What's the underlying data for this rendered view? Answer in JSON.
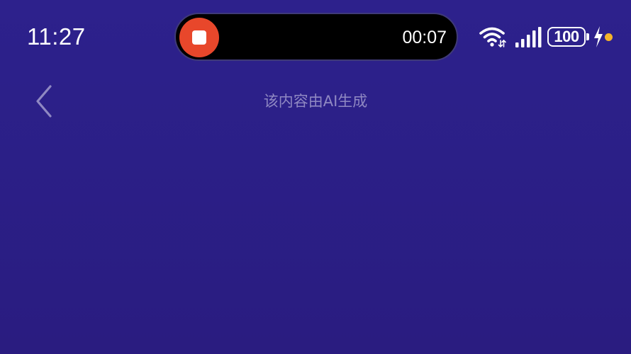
{
  "status_bar": {
    "time": "11:27",
    "recording": {
      "elapsed": "00:07",
      "stop_icon": "stop-icon",
      "accent": "#e8472b"
    },
    "wifi_icon": "wifi-icon",
    "signal_icon": "cellular-signal-icon",
    "battery": {
      "level": "100",
      "charging_icon": "lightning-bolt-icon",
      "indicator_color": "#f4b32a"
    }
  },
  "header": {
    "back_icon": "chevron-left-icon",
    "title": "该内容由AI生成"
  },
  "theme": {
    "background": "#2b1f87"
  }
}
